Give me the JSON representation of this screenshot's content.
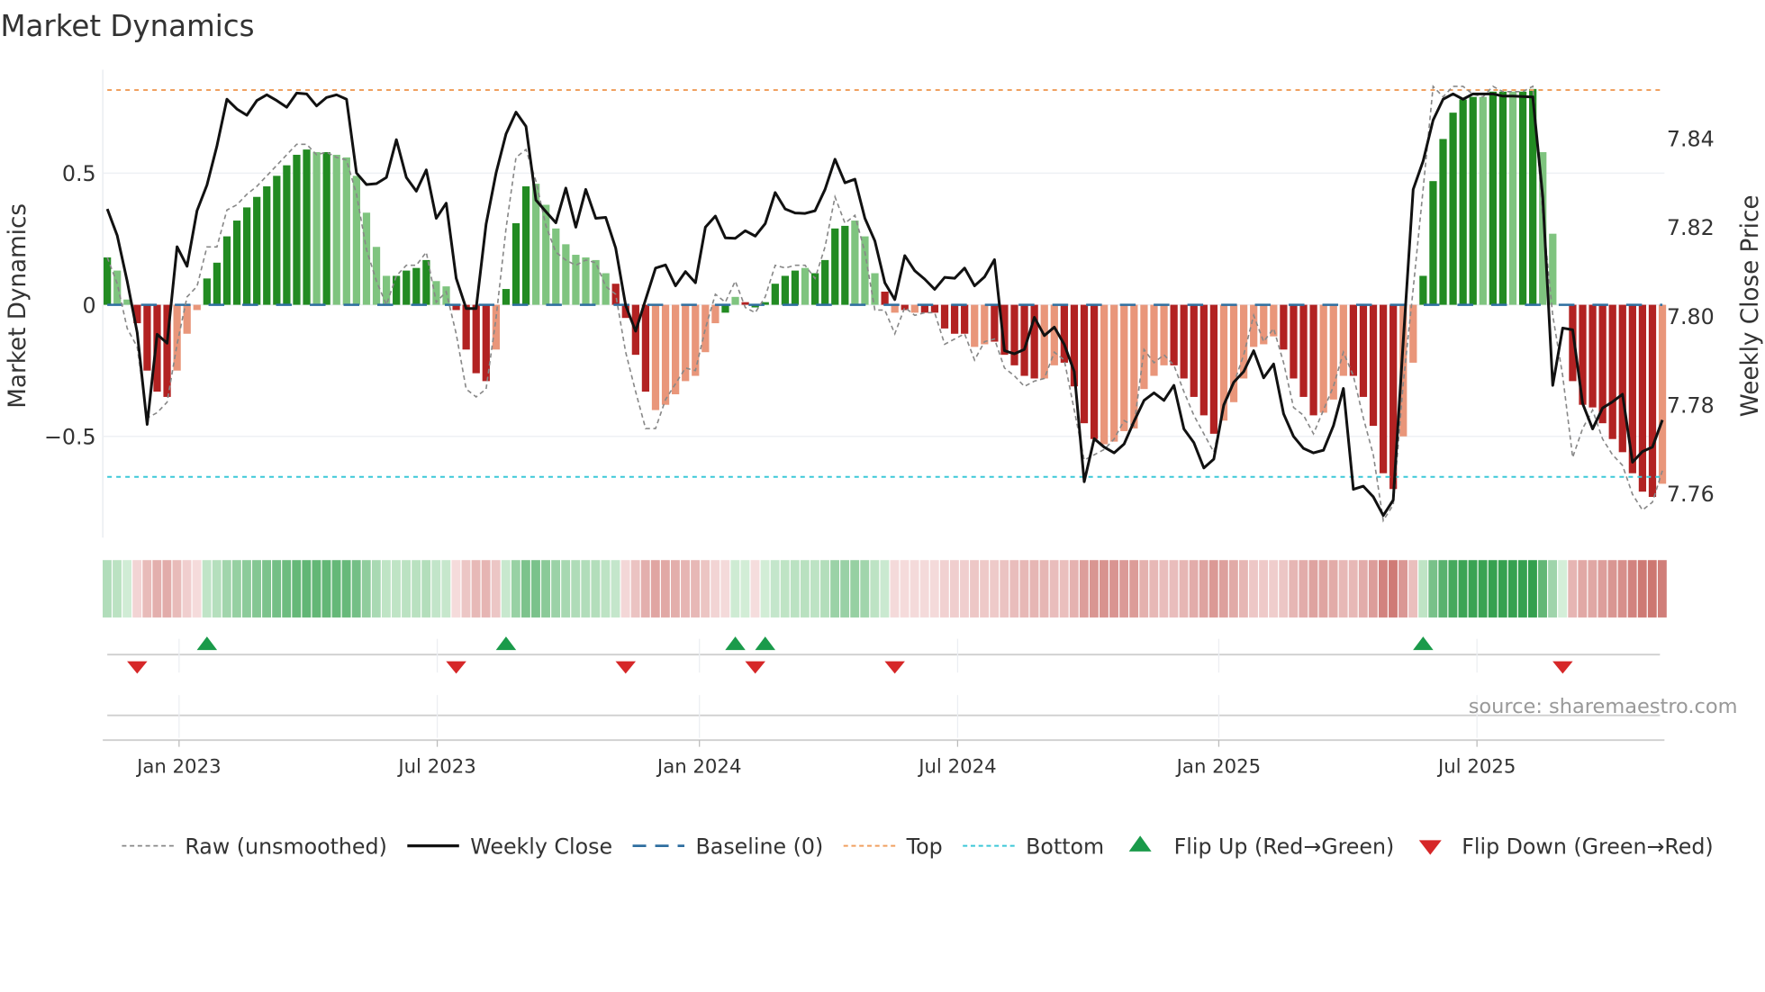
{
  "chart_data": {
    "type": "bar",
    "title": "Market Dynamics",
    "ylabel": "Market Dynamics",
    "y2label": "Weekly Close Price",
    "ylim": [
      -0.88,
      0.88
    ],
    "y2lim": [
      7.7475,
      7.8588
    ],
    "yticks": [
      {
        "v": 0.5,
        "label": "0.5"
      },
      {
        "v": 0,
        "label": "0"
      },
      {
        "v": -0.5,
        "label": "−0.5"
      }
    ],
    "y2ticks": [
      {
        "v": 7.84,
        "label": "7.84"
      },
      {
        "v": 7.82,
        "label": "7.82"
      },
      {
        "v": 7.8,
        "label": "7.80"
      },
      {
        "v": 7.78,
        "label": "7.78"
      },
      {
        "v": 7.76,
        "label": "7.76"
      }
    ],
    "xticks": [
      {
        "week": 7.2,
        "label": "Jan 2023"
      },
      {
        "week": 33.1,
        "label": "Jul 2023"
      },
      {
        "week": 59.4,
        "label": "Jan 2024"
      },
      {
        "week": 85.3,
        "label": "Jul 2024"
      },
      {
        "week": 111.5,
        "label": "Jan 2025"
      },
      {
        "week": 137.4,
        "label": "Jul 2025"
      }
    ],
    "top_level": 0.816,
    "bottom_level": -0.654,
    "baseline": 0,
    "values": [
      0.18,
      0.13,
      0.02,
      -0.07,
      -0.25,
      -0.33,
      -0.35,
      -0.25,
      -0.11,
      -0.02,
      0.1,
      0.16,
      0.26,
      0.32,
      0.37,
      0.41,
      0.45,
      0.49,
      0.53,
      0.57,
      0.59,
      0.58,
      0.58,
      0.57,
      0.56,
      0.49,
      0.35,
      0.22,
      0.11,
      0.11,
      0.13,
      0.14,
      0.17,
      0.09,
      0.07,
      -0.02,
      -0.17,
      -0.26,
      -0.29,
      -0.17,
      0.06,
      0.31,
      0.45,
      0.46,
      0.38,
      0.29,
      0.23,
      0.19,
      0.18,
      0.17,
      0.12,
      0.08,
      -0.05,
      -0.19,
      -0.33,
      -0.4,
      -0.38,
      -0.34,
      -0.29,
      -0.27,
      -0.18,
      -0.07,
      -0.03,
      0.03,
      0.01,
      -0.01,
      0.01,
      0.08,
      0.11,
      0.13,
      0.14,
      0.12,
      0.17,
      0.29,
      0.3,
      0.32,
      0.26,
      0.12,
      0.05,
      -0.03,
      -0.02,
      -0.03,
      -0.03,
      -0.03,
      -0.09,
      -0.11,
      -0.11,
      -0.16,
      -0.15,
      -0.14,
      -0.19,
      -0.23,
      -0.27,
      -0.28,
      -0.28,
      -0.23,
      -0.22,
      -0.31,
      -0.45,
      -0.51,
      -0.53,
      -0.52,
      -0.48,
      -0.47,
      -0.32,
      -0.27,
      -0.23,
      -0.23,
      -0.28,
      -0.35,
      -0.42,
      -0.49,
      -0.44,
      -0.37,
      -0.28,
      -0.16,
      -0.15,
      -0.12,
      -0.17,
      -0.28,
      -0.35,
      -0.42,
      -0.41,
      -0.36,
      -0.27,
      -0.27,
      -0.35,
      -0.46,
      -0.64,
      -0.7,
      -0.5,
      -0.22,
      0.11,
      0.47,
      0.63,
      0.73,
      0.78,
      0.79,
      0.79,
      0.81,
      0.81,
      0.81,
      0.81,
      0.82,
      0.58,
      0.27,
      0.0,
      -0.29,
      -0.38,
      -0.39,
      -0.45,
      -0.51,
      -0.56,
      -0.64,
      -0.71,
      -0.73,
      -0.68
    ],
    "shades": "GggRRRRrrrGGGGGGGGGGGgGggggggGGGGggRRRRrGGGggggggggRRRRrrrrrrrGgRGGGGGgGGGGgggRrRrRRRRRrrRRRRRrrRRRRrrrrrrrRRRRRrrrrrrRRRRrrrRRRRRrrGGGGGGgGGgGGgg-RRRRRRRRRr",
    "raw": [
      0.18,
      0.08,
      -0.09,
      -0.16,
      -0.43,
      -0.41,
      -0.37,
      -0.15,
      0.03,
      0.07,
      0.22,
      0.22,
      0.36,
      0.38,
      0.42,
      0.45,
      0.49,
      0.53,
      0.57,
      0.61,
      0.61,
      0.57,
      0.58,
      0.56,
      0.55,
      0.42,
      0.21,
      0.09,
      0.0,
      0.11,
      0.15,
      0.15,
      0.2,
      0.01,
      0.05,
      -0.11,
      -0.32,
      -0.35,
      -0.32,
      -0.05,
      0.29,
      0.56,
      0.59,
      0.47,
      0.3,
      0.2,
      0.17,
      0.15,
      0.17,
      0.16,
      0.07,
      0.04,
      -0.18,
      -0.33,
      -0.47,
      -0.47,
      -0.36,
      -0.3,
      -0.24,
      -0.25,
      -0.09,
      0.04,
      0.01,
      0.09,
      -0.01,
      -0.03,
      0.03,
      0.15,
      0.14,
      0.15,
      0.15,
      0.1,
      0.22,
      0.41,
      0.31,
      0.34,
      0.2,
      -0.02,
      -0.02,
      -0.11,
      -0.01,
      -0.04,
      -0.03,
      -0.03,
      -0.15,
      -0.13,
      -0.11,
      -0.21,
      -0.14,
      -0.13,
      -0.24,
      -0.27,
      -0.31,
      -0.29,
      -0.28,
      -0.18,
      -0.21,
      -0.4,
      -0.59,
      -0.57,
      -0.55,
      -0.51,
      -0.44,
      -0.46,
      -0.17,
      -0.22,
      -0.19,
      -0.23,
      -0.33,
      -0.42,
      -0.49,
      -0.56,
      -0.39,
      -0.3,
      -0.19,
      -0.04,
      -0.14,
      -0.09,
      -0.22,
      -0.39,
      -0.42,
      -0.49,
      -0.4,
      -0.31,
      -0.18,
      -0.27,
      -0.43,
      -0.57,
      -0.82,
      -0.76,
      -0.3,
      0.06,
      0.44,
      0.83,
      0.79,
      0.83,
      0.83,
      0.8,
      0.79,
      0.83,
      0.81,
      0.81,
      0.81,
      0.83,
      0.34,
      -0.04,
      -0.27,
      -0.58,
      -0.47,
      -0.4,
      -0.51,
      -0.57,
      -0.61,
      -0.72,
      -0.78,
      -0.75,
      -0.63
    ],
    "weekly_close": [
      7.8241,
      7.8181,
      7.8078,
      7.7963,
      7.7756,
      7.7959,
      7.7939,
      7.8156,
      7.8112,
      7.8237,
      7.8295,
      7.8383,
      7.8488,
      7.8466,
      7.8452,
      7.8485,
      7.8498,
      7.8485,
      7.847,
      7.8502,
      7.85,
      7.8473,
      7.8492,
      7.8498,
      7.8488,
      7.8322,
      7.8296,
      7.8298,
      7.8312,
      7.8397,
      7.8312,
      7.8281,
      7.8329,
      7.822,
      7.8254,
      7.8085,
      7.8017,
      7.8017,
      7.8207,
      7.8322,
      7.841,
      7.8459,
      7.8427,
      7.8261,
      7.8235,
      7.821,
      7.8288,
      7.82,
      7.8285,
      7.822,
      7.8222,
      7.8153,
      7.8024,
      7.7966,
      7.8037,
      7.8108,
      7.8115,
      7.8068,
      7.81,
      7.8075,
      7.82,
      7.8225,
      7.8176,
      7.8175,
      7.8192,
      7.818,
      7.8208,
      7.8278,
      7.8241,
      7.8232,
      7.8231,
      7.8237,
      7.8285,
      7.8353,
      7.83,
      7.8308,
      7.822,
      7.8169,
      7.8075,
      7.8037,
      7.8136,
      7.8102,
      7.8083,
      7.806,
      7.8087,
      7.8085,
      7.8108,
      7.8068,
      7.8088,
      7.8127,
      7.7922,
      7.7915,
      7.7925,
      7.7997,
      7.7956,
      7.7975,
      7.7936,
      7.7875,
      7.7627,
      7.7724,
      7.7705,
      7.7692,
      7.7712,
      7.7763,
      7.781,
      7.7827,
      7.781,
      7.7844,
      7.7746,
      7.7715,
      7.7658,
      7.7678,
      7.78,
      7.7851,
      7.7875,
      7.7922,
      7.7861,
      7.7892,
      7.778,
      7.7729,
      7.7702,
      7.7692,
      7.7698,
      7.7753,
      7.7837,
      7.761,
      7.7617,
      7.7593,
      7.7551,
      7.7586,
      7.7942,
      7.8285,
      7.8349,
      7.8441,
      7.8488,
      7.85,
      7.8488,
      7.85,
      7.85,
      7.85,
      7.8495,
      7.8495,
      7.8494,
      7.8493,
      7.8268,
      7.7844,
      7.7973,
      7.7969,
      7.7803,
      7.7746,
      7.7793,
      7.7807,
      7.7824,
      7.7671,
      7.7695,
      7.7705,
      7.7766
    ],
    "flip_up_weeks": [
      10,
      40,
      63,
      66,
      132
    ],
    "flip_down_weeks": [
      3,
      35,
      52,
      65,
      79,
      146
    ],
    "colors": {
      "green_dark": "#228b22",
      "green_light": "#7fc47f",
      "red_dark": "#b22222",
      "red_light": "#e9967a",
      "close": "#111111",
      "raw": "#888888",
      "baseline": "#2f6fa0",
      "top": "#f0a060",
      "bottom": "#3cc8d8",
      "flip_up": "#1a9a4a",
      "flip_down": "#d62728"
    },
    "legend": [
      {
        "label": "Raw (unsmoothed)",
        "symbol": "raw"
      },
      {
        "label": "Weekly Close",
        "symbol": "close"
      },
      {
        "label": "Baseline (0)",
        "symbol": "baseline"
      },
      {
        "label": "Top",
        "symbol": "top"
      },
      {
        "label": "Bottom",
        "symbol": "bottom"
      },
      {
        "label": "Flip Up (Red→Green)",
        "symbol": "flip_up"
      },
      {
        "label": "Flip Down (Green→Red)",
        "symbol": "flip_down"
      }
    ],
    "legend_placement": "bottom",
    "source": "source: sharemaestro.com"
  }
}
